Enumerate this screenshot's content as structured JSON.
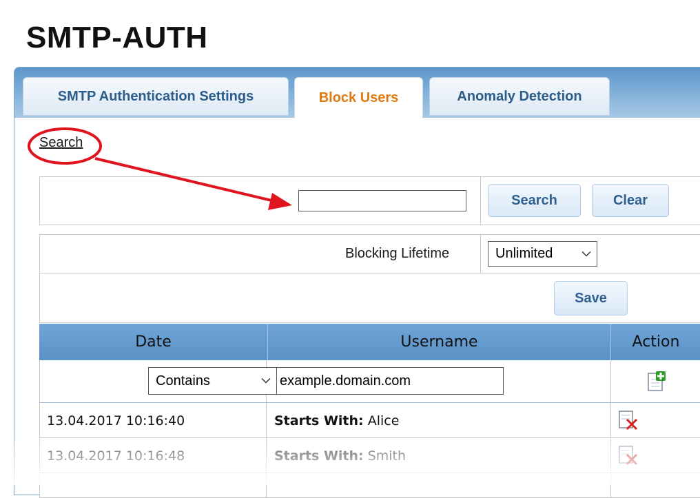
{
  "page": {
    "title": "SMTP-AUTH"
  },
  "tabs": [
    {
      "label": "SMTP Authentication Settings",
      "active": false
    },
    {
      "label": "Block Users",
      "active": true
    },
    {
      "label": "Anomaly Detection",
      "active": false
    }
  ],
  "search_link": "Search",
  "search_panel": {
    "query": "",
    "search_label": "Search",
    "clear_label": "Clear"
  },
  "settings": {
    "lifetime_label": "Blocking Lifetime",
    "lifetime_value": "Unlimited",
    "save_label": "Save"
  },
  "table": {
    "columns": [
      "Date",
      "Username",
      "Action"
    ],
    "filter": {
      "match_type": "Contains",
      "value": "example.domain.com"
    },
    "rows": [
      {
        "date": "13.04.2017 10:16:40",
        "rule": "Starts With:",
        "name": "Alice"
      },
      {
        "date": "13.04.2017 10:16:48",
        "rule": "Starts With:",
        "name": "Smith"
      }
    ]
  },
  "colors": {
    "accent_tab": "#e07a10",
    "annotation": "#e0141e",
    "header_blue": "#5b93c7"
  },
  "icons": {
    "add": "add-icon",
    "delete": "delete-icon",
    "dropdown": "chevron-down-icon"
  }
}
